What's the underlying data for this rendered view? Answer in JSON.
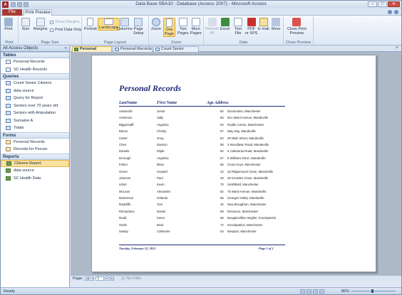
{
  "window": {
    "title": "Data Base SBA10 : Database (Access 2007) - Microsoft Access",
    "minimize": "–",
    "maximize": "□",
    "close": "✕",
    "app_icon_letter": "A"
  },
  "tabs": {
    "file": "File",
    "print_preview": "Print Preview"
  },
  "ribbon": {
    "groups": {
      "print": "Print",
      "page_size": "Page Size",
      "page_layout": "Page Layout",
      "zoom": "Zoom",
      "data": "Data",
      "close_preview": "Close Preview"
    },
    "print_btn": "Print",
    "size_btn": "Size",
    "margins_btn": "Margins",
    "show_margins": "Show Margins",
    "print_data_only": "Print Data Only",
    "portrait_btn": "Portrait",
    "landscape_btn": "Landscape",
    "columns_btn": "Columns",
    "page_setup_btn": "Page\nSetup",
    "zoom_btn": "Zoom",
    "one_page_btn": "One\nPage",
    "two_pages_btn": "Two\nPages",
    "more_pages_btn": "More\nPages",
    "refresh_all_btn": "Refresh\nAll",
    "excel_btn": "Excel",
    "text_file_btn": "Text\nFile",
    "pdf_btn": "PDF\nor XPS",
    "email_btn": "E-mail",
    "more_btn": "More",
    "close_preview_btn": "Close Print\nPreview"
  },
  "nav": {
    "header": "All Access Objects",
    "sections": [
      {
        "label": "Tables",
        "items": [
          "Personal Records",
          "SC Health Records"
        ]
      },
      {
        "label": "Queries",
        "items": [
          "Count Senior Citizens",
          "data source",
          "Query for Report",
          "Seniors over 70 years old",
          "Seniors with Amputation",
          "Surname A",
          "Totals"
        ]
      },
      {
        "label": "Forms",
        "items": [
          "Personal Records",
          "Records for Peruse"
        ]
      },
      {
        "label": "Reports",
        "items": [
          "Citizens Report",
          "data source",
          "SC Health Data"
        ]
      }
    ]
  },
  "doc_tabs": [
    "Personal Records",
    "Personal Records",
    "Count Senior Citizens"
  ],
  "report": {
    "title": "Personal Records",
    "headers": {
      "last": "LastName",
      "first": "First Name",
      "age_address": "Age Address"
    },
    "rows": [
      [
        "Ainsworth",
        "Junior",
        "60",
        "Dunsmaine, Manchester"
      ],
      [
        "Anderson",
        "Sally",
        "60",
        "81A Ward Avenue, Mandeville"
      ],
      [
        "Biggerstaff",
        "Angelica",
        "54",
        "Rudds Corner, Manchester"
      ],
      [
        "Bloom",
        "Christy",
        "67",
        "Way Day, Mandeville"
      ],
      [
        "Carter",
        "Greg",
        "64",
        "29 Main Street, Mandeville"
      ],
      [
        "Chen",
        "Damion",
        "58",
        "3 Woodlawn Road, Mandeville"
      ],
      [
        "Daniels",
        "Elijah",
        "62",
        "5 Caledonia Road, Mandeville"
      ],
      [
        "Dorough",
        "Angelica",
        "67",
        "5 Williams Drive, Mandeville"
      ],
      [
        "Felton",
        "Brian",
        "65",
        "Cross Keys, Manchester"
      ],
      [
        "Green",
        "Howard",
        "44",
        "33 Ridgemount Close, Mandeville"
      ],
      [
        "Johnson",
        "Paul",
        "49",
        "30 Knowles Close, Mandeville"
      ],
      [
        "Littrel",
        "Kevin",
        "70",
        "Smithfield, Manchester"
      ],
      [
        "McLean",
        "Alexander",
        "62",
        "75 Ward Avenue, Mandeville"
      ],
      [
        "Mortenson",
        "Orlando",
        "56",
        "Georges Valley, Mandeville"
      ],
      [
        "Radcliffe",
        "Tom",
        "40",
        "New Broughton, Manchester"
      ],
      [
        "Richardson",
        "Daniel",
        "59",
        "Resource, Manchester"
      ],
      [
        "Rudd",
        "Karen",
        "69",
        "Bougainvillea Heights, Knockpatrick"
      ],
      [
        "Smith",
        "Brad",
        "72",
        "Knockpatrick, Manchester"
      ],
      [
        "Swaby",
        "Catherine",
        "64",
        "Newport, Manchester"
      ]
    ],
    "footer_date": "Tuesday, February 22, 2011",
    "footer_page": "Page 1 of 1"
  },
  "pagebar": {
    "label": "Page:",
    "current": "1",
    "filter": "No Filter"
  },
  "status": {
    "text": "Ready",
    "zoom": "86%"
  }
}
